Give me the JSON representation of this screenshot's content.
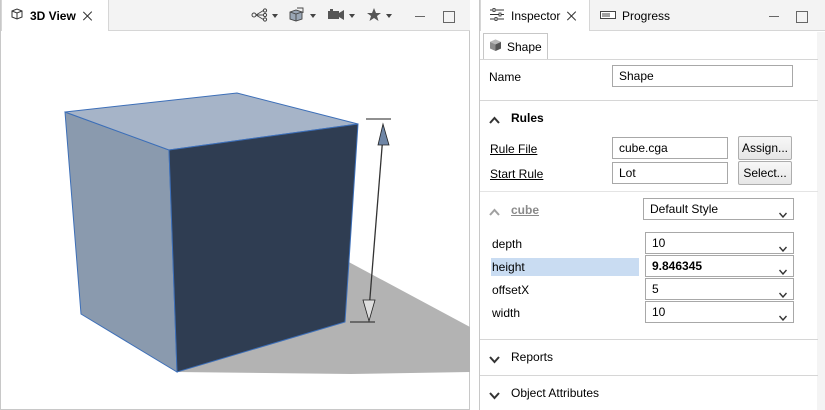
{
  "view": {
    "tab_label": "3D View",
    "toolbar": [
      {
        "icon": "scene-graph-icon",
        "has_menu": true
      },
      {
        "icon": "display-mode-cube-icon",
        "has_menu": true
      },
      {
        "icon": "camera-icon",
        "has_menu": true
      },
      {
        "icon": "bookmark-star-icon",
        "has_menu": true
      }
    ],
    "scene": {
      "object": "cube",
      "face_colors": {
        "top": "#a6b4c8",
        "left": "#8a9aae",
        "front": "#2f3d52",
        "shadow": "#b3b3b3",
        "edge": "#3d6fb8"
      },
      "height_handle": "vertical-dimension-arrow"
    }
  },
  "inspector": {
    "tabs": [
      {
        "label": "Inspector",
        "active": true,
        "icon": "sliders-icon"
      },
      {
        "label": "Progress",
        "active": false,
        "icon": "progress-icon"
      }
    ],
    "object_tab": {
      "label": "Shape",
      "icon": "shape-cube-icon"
    },
    "name": {
      "label": "Name",
      "value": "Shape"
    },
    "rules": {
      "title": "Rules",
      "rule_file": {
        "label": "Rule File",
        "value": "cube.cga",
        "button": "Assign..."
      },
      "start_rule": {
        "label": "Start Rule",
        "value": "Lot",
        "button": "Select..."
      }
    },
    "cube": {
      "title": "cube",
      "style": "Default Style",
      "params": [
        {
          "label": "depth",
          "value": "10",
          "selected": false,
          "bold": false
        },
        {
          "label": "height",
          "value": "9.846345",
          "selected": true,
          "bold": true
        },
        {
          "label": "offsetX",
          "value": "5",
          "selected": false,
          "bold": false
        },
        {
          "label": "width",
          "value": "10",
          "selected": false,
          "bold": false
        }
      ]
    },
    "reports": {
      "title": "Reports"
    },
    "object_attributes": {
      "title": "Object Attributes"
    }
  }
}
